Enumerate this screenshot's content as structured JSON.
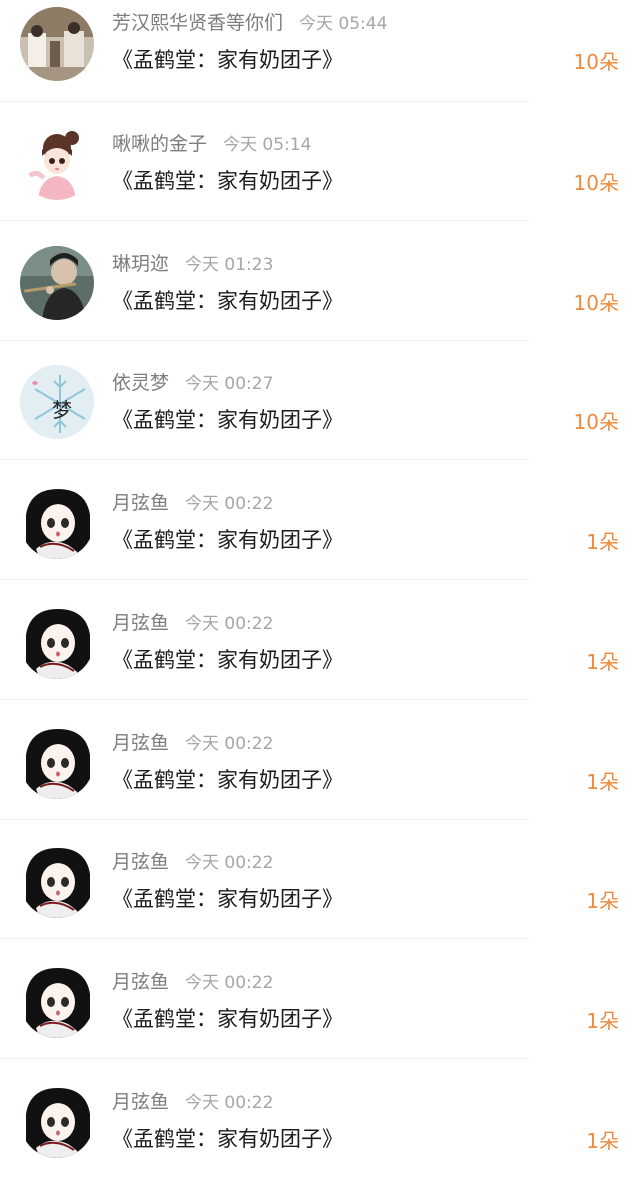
{
  "messages": [
    {
      "user": "芳汉熙华贤香等你们",
      "time": "今天 05:44",
      "gift": "《孟鹤堂：家有奶团子》",
      "count": "10朵",
      "avatar": "couple-photo"
    },
    {
      "user": "啾啾的金子",
      "time": "今天 05:14",
      "gift": "《孟鹤堂：家有奶团子》",
      "count": "10朵",
      "avatar": "anime-girl"
    },
    {
      "user": "琳玥迩",
      "time": "今天 01:23",
      "gift": "《孟鹤堂：家有奶团子》",
      "count": "10朵",
      "avatar": "flute-player"
    },
    {
      "user": "依灵梦",
      "time": "今天 00:27",
      "gift": "《孟鹤堂：家有奶团子》",
      "count": "10朵",
      "avatar": "snowflake-meng"
    },
    {
      "user": "月弦鱼",
      "time": "今天 00:22",
      "gift": "《孟鹤堂：家有奶团子》",
      "count": "1朵",
      "avatar": "anime-dark-hair"
    },
    {
      "user": "月弦鱼",
      "time": "今天 00:22",
      "gift": "《孟鹤堂：家有奶团子》",
      "count": "1朵",
      "avatar": "anime-dark-hair"
    },
    {
      "user": "月弦鱼",
      "time": "今天 00:22",
      "gift": "《孟鹤堂：家有奶团子》",
      "count": "1朵",
      "avatar": "anime-dark-hair"
    },
    {
      "user": "月弦鱼",
      "time": "今天 00:22",
      "gift": "《孟鹤堂：家有奶团子》",
      "count": "1朵",
      "avatar": "anime-dark-hair"
    },
    {
      "user": "月弦鱼",
      "time": "今天 00:22",
      "gift": "《孟鹤堂：家有奶团子》",
      "count": "1朵",
      "avatar": "anime-dark-hair"
    },
    {
      "user": "月弦鱼",
      "time": "今天 00:22",
      "gift": "《孟鹤堂：家有奶团子》",
      "count": "1朵",
      "avatar": "anime-dark-hair"
    }
  ],
  "colors": {
    "accent_count": "#ef8a3b",
    "name_text": "#7d7d7d",
    "time_text": "#a6a6a6",
    "gift_text": "#1b1b1b"
  },
  "snowflake_avatar_char": "梦"
}
